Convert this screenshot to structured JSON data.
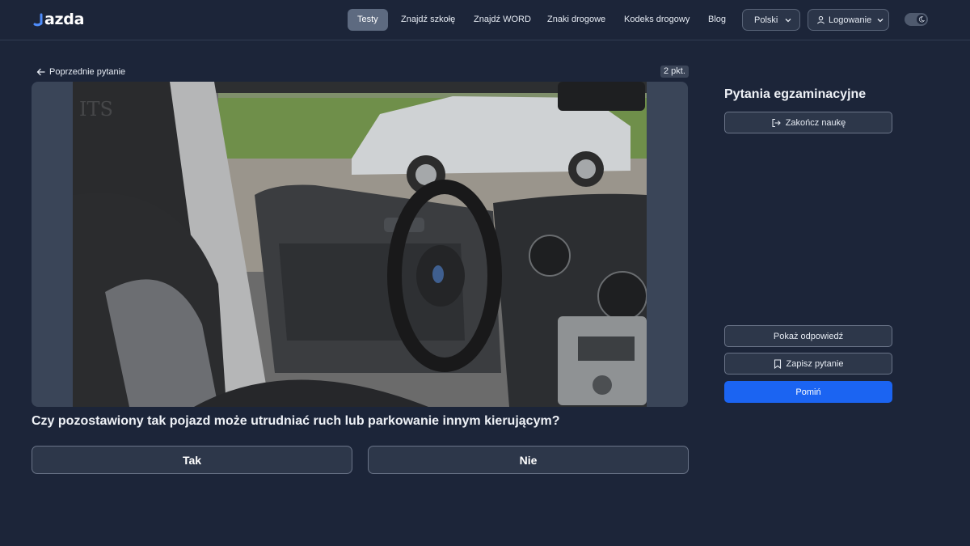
{
  "brand": {
    "name": "azda"
  },
  "nav": {
    "items": [
      {
        "label": "Testy",
        "active": true
      },
      {
        "label": "Znajdź szkołę"
      },
      {
        "label": "Znajdź WORD"
      },
      {
        "label": "Znaki drogowe"
      },
      {
        "label": "Kodeks drogowy"
      },
      {
        "label": "Blog"
      }
    ],
    "language": "Polski",
    "login": "Logowanie",
    "theme_icon": "moon-icon"
  },
  "question_nav": {
    "back_label": "Poprzednie pytanie",
    "points": "2 pkt."
  },
  "question": {
    "text": "Czy pozostawiony tak pojazd może utrudniać ruch lub parkowanie innym kierującym?",
    "answers": [
      "Tak",
      "Nie"
    ]
  },
  "sidebar": {
    "title": "Pytania egzaminacyjne",
    "end_label": "Zakończ naukę",
    "show_answer_label": "Pokaż odpowiedź",
    "save_label": "Zapisz pytanie",
    "skip_label": "Pomiń"
  },
  "colors": {
    "background": "#1c2539",
    "primary": "#1b64f2",
    "active_nav": "#5d6a80"
  }
}
